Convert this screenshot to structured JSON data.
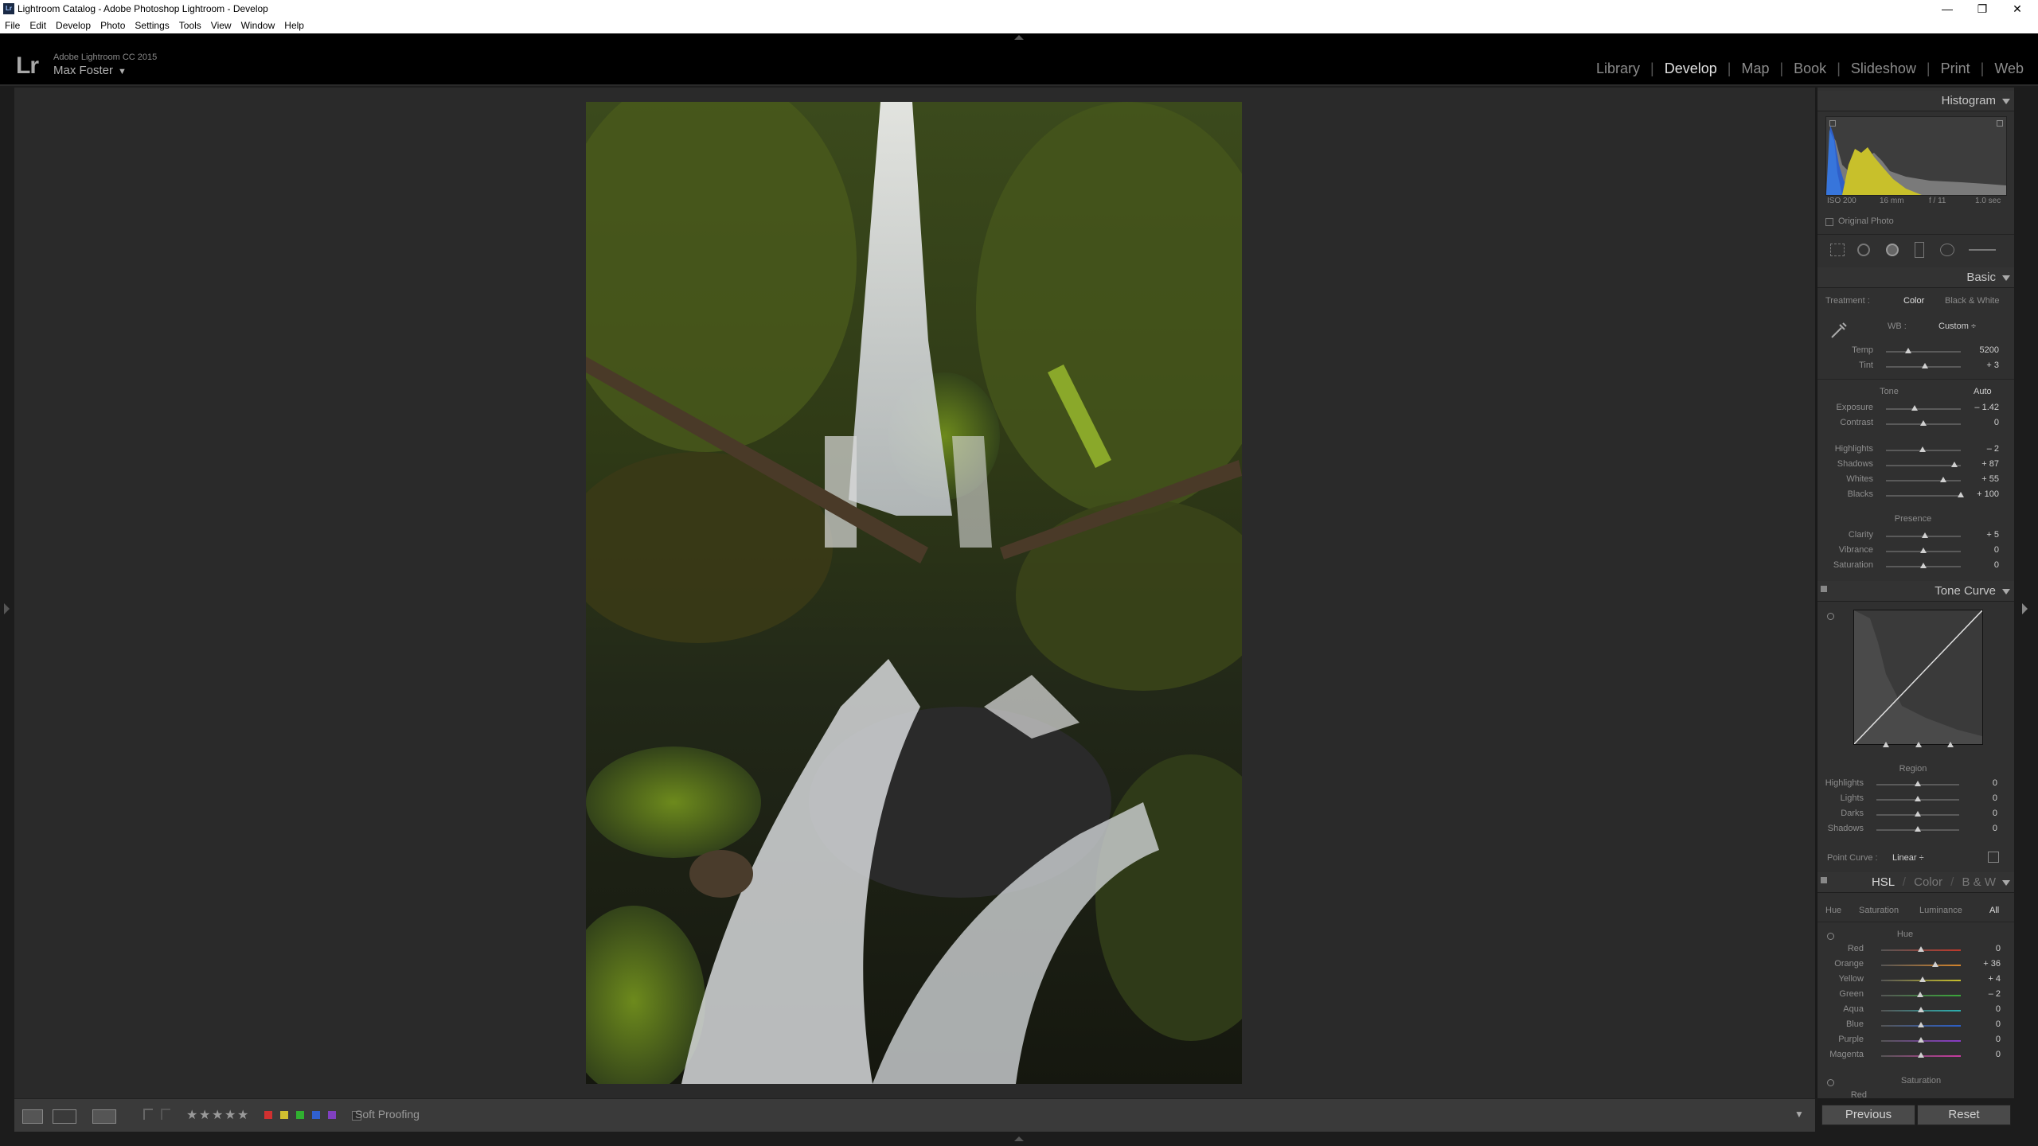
{
  "window": {
    "title": "Lightroom Catalog - Adobe Photoshop Lightroom - Develop",
    "controls": {
      "minimize": "—",
      "maximize": "❐",
      "close": "✕"
    }
  },
  "menu": [
    "File",
    "Edit",
    "Develop",
    "Photo",
    "Settings",
    "Tools",
    "View",
    "Window",
    "Help"
  ],
  "identity": {
    "logo": "Lr",
    "product": "Adobe Lightroom CC 2015",
    "user": "Max Foster",
    "user_arrow": "▼"
  },
  "modules": [
    {
      "label": "Library",
      "active": false
    },
    {
      "label": "Develop",
      "active": true
    },
    {
      "label": "Map",
      "active": false
    },
    {
      "label": "Book",
      "active": false
    },
    {
      "label": "Slideshow",
      "active": false
    },
    {
      "label": "Print",
      "active": false
    },
    {
      "label": "Web",
      "active": false
    }
  ],
  "histogram": {
    "title": "Histogram",
    "iso": "ISO 200",
    "focal": "16 mm",
    "aperture": "f / 11",
    "shutter": "1.0 sec",
    "original_photo": "Original Photo"
  },
  "basic": {
    "title": "Basic",
    "treatment_label": "Treatment :",
    "treatment_color": "Color",
    "treatment_bw": "Black & White",
    "wb_label": "WB :",
    "wb_value": "Custom",
    "wb_arrow": "÷",
    "wb_sliders": [
      {
        "label": "Temp",
        "value": "5200",
        "pos": 0.3
      },
      {
        "label": "Tint",
        "value": "+ 3",
        "pos": 0.52
      }
    ],
    "tone_label": "Tone",
    "auto": "Auto",
    "tone_sliders": [
      {
        "label": "Exposure",
        "value": "– 1.42",
        "pos": 0.38
      },
      {
        "label": "Contrast",
        "value": "0",
        "pos": 0.5
      }
    ],
    "tone_sliders2": [
      {
        "label": "Highlights",
        "value": "– 2",
        "pos": 0.49
      },
      {
        "label": "Shadows",
        "value": "+ 87",
        "pos": 0.92
      },
      {
        "label": "Whites",
        "value": "+ 55",
        "pos": 0.77
      },
      {
        "label": "Blacks",
        "value": "+ 100",
        "pos": 1.0
      }
    ],
    "presence_label": "Presence",
    "presence_sliders": [
      {
        "label": "Clarity",
        "value": "+ 5",
        "pos": 0.52
      },
      {
        "label": "Vibrance",
        "value": "0",
        "pos": 0.5
      },
      {
        "label": "Saturation",
        "value": "0",
        "pos": 0.5
      }
    ]
  },
  "tone_curve": {
    "title": "Tone Curve",
    "region_label": "Region",
    "region_sliders": [
      {
        "label": "Highlights",
        "value": "0",
        "pos": 0.5
      },
      {
        "label": "Lights",
        "value": "0",
        "pos": 0.5
      },
      {
        "label": "Darks",
        "value": "0",
        "pos": 0.5
      },
      {
        "label": "Shadows",
        "value": "0",
        "pos": 0.5
      }
    ],
    "point_curve_label": "Point Curve :",
    "point_curve_value": "Linear",
    "point_curve_arrow": "÷"
  },
  "hsl": {
    "tab_hsl": "HSL",
    "tab_color": "Color",
    "tab_bw": "B & W",
    "slash": "/",
    "subtabs": [
      "Hue",
      "Saturation",
      "Luminance",
      "All"
    ],
    "hue_label": "Hue",
    "hue_sliders": [
      {
        "label": "Red",
        "value": "0",
        "pos": 0.5,
        "color": "#c0392b"
      },
      {
        "label": "Orange",
        "value": "+ 36",
        "pos": 0.68,
        "color": "#d4842b"
      },
      {
        "label": "Yellow",
        "value": "+ 4",
        "pos": 0.52,
        "color": "#c8c02b"
      },
      {
        "label": "Green",
        "value": "– 2",
        "pos": 0.49,
        "color": "#3aa83a"
      },
      {
        "label": "Aqua",
        "value": "0",
        "pos": 0.5,
        "color": "#2bb0b0"
      },
      {
        "label": "Blue",
        "value": "0",
        "pos": 0.5,
        "color": "#2b5fc8"
      },
      {
        "label": "Purple",
        "value": "0",
        "pos": 0.5,
        "color": "#8a3ac8"
      },
      {
        "label": "Magenta",
        "value": "0",
        "pos": 0.5,
        "color": "#c83aa0"
      }
    ],
    "saturation_label": "Saturation",
    "sat_first": "Red"
  },
  "buttons": {
    "previous": "Previous",
    "reset": "Reset"
  },
  "toolbar": {
    "stars": [
      "★",
      "★",
      "★",
      "★",
      "★"
    ],
    "labels": [
      "#d03030",
      "#d0c030",
      "#30b030",
      "#3060d0",
      "#8040c0"
    ],
    "soft_proofing": "Soft Proofing",
    "dropdown": "▼"
  }
}
